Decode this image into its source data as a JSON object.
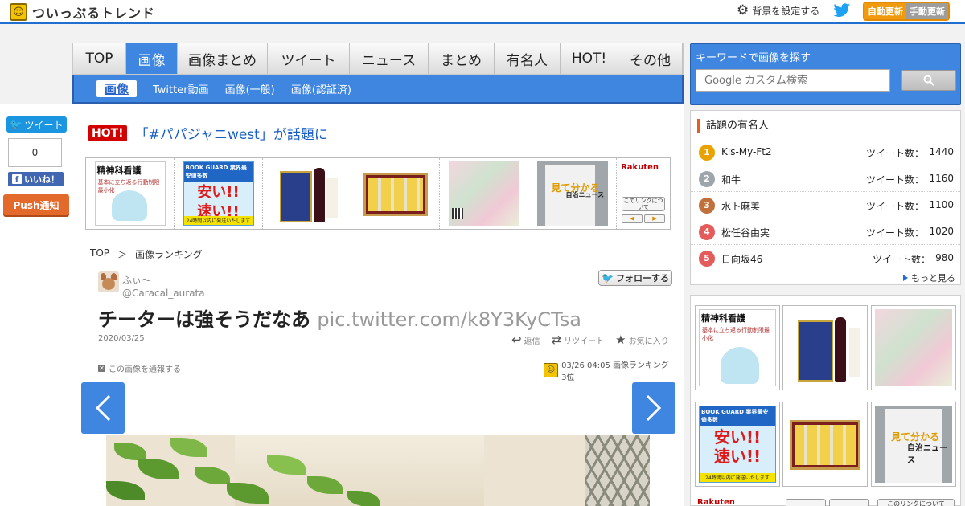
{
  "header": {
    "site_title": "ついっぷるトレンド",
    "bg_setting": "背景を設定する",
    "auto_update": "自動更新",
    "manual_update": "手動更新"
  },
  "social": {
    "tweet_label": "ツイート",
    "like_count": "0",
    "like_label": "いいね！",
    "push_label": "Push通知"
  },
  "nav": {
    "tabs": [
      {
        "label": "TOP",
        "width": 66
      },
      {
        "label": "画像",
        "width": 64,
        "active": true
      },
      {
        "label": "画像まとめ",
        "width": 112
      },
      {
        "label": "ツイート",
        "width": 102
      },
      {
        "label": "ニュース",
        "width": 98
      },
      {
        "label": "まとめ",
        "width": 82
      },
      {
        "label": "有名人",
        "width": 82
      },
      {
        "label": "HOT!",
        "width": 72
      },
      {
        "label": "その他",
        "width": 80
      }
    ],
    "sub": [
      "画像",
      "Twitter動画",
      "画像(一般)",
      "画像(認証済)"
    ]
  },
  "hot": {
    "badge": "HOT!",
    "text": "「#パパジャニwest」が話題に"
  },
  "ads": {
    "book1_title": "精神科看護",
    "book1_sub": "基本に立ち返る行動制限最小化",
    "bookguard_header": "BOOK GUARD 業界最安値多数",
    "bookguard_big1": "安い!!",
    "bookguard_big2": "速い!!",
    "bookguard_footer": "24時間以内に発送いたします",
    "jichi_text": "自治ニュース",
    "jichi_top": "見て分かる",
    "rakuten": "Rakuten",
    "info": "このリンクについて"
  },
  "breadcrumb": {
    "top": "TOP",
    "sep": "＞",
    "current": "画像ランキング"
  },
  "tweet": {
    "name": "ふぃ〜",
    "handle": "@Caracal_aurata",
    "follow": "フォローする",
    "text": "チーターは強そうだなあ",
    "link": "pic.twitter.com/k8Y3KyCTsa",
    "date": "2020/03/25",
    "reply": "返信",
    "retweet": "リツイート",
    "favorite": "お気に入り",
    "report": "この画像を通報する",
    "rank_info": "03/26 04:05 画像ランキング3位"
  },
  "search": {
    "title": "キーワードで画像を探す",
    "placeholder": "Google カスタム検索"
  },
  "celebs": {
    "title": "話題の有名人",
    "label": "ツイート数：",
    "more": "もっと見る",
    "items": [
      {
        "rank": "1",
        "name": "Kis-My-Ft2",
        "count": "1440",
        "color": "#e8a300"
      },
      {
        "rank": "2",
        "name": "和牛",
        "count": "1160",
        "color": "#9ea6ad"
      },
      {
        "rank": "3",
        "name": "水卜麻美",
        "count": "1100",
        "color": "#c0703a"
      },
      {
        "rank": "4",
        "name": "松任谷由実",
        "count": "1020",
        "color": "#e55a5a"
      },
      {
        "rank": "5",
        "name": "日向坂46",
        "count": "980",
        "color": "#e55a5a"
      }
    ]
  },
  "side": {
    "rakuten": "Rakuten",
    "info": "このリンクについて"
  }
}
